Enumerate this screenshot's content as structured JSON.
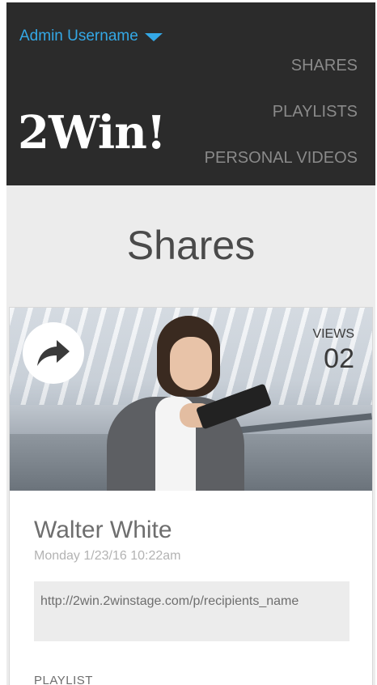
{
  "header": {
    "user_menu_label": "Admin Username",
    "logo": "2Win!",
    "nav": [
      {
        "label": "SHARES"
      },
      {
        "label": "PLAYLISTS"
      },
      {
        "label": "PERSONAL VIDEOS"
      }
    ]
  },
  "page": {
    "title": "Shares"
  },
  "card": {
    "views_label": "VIEWS",
    "views_count": "02",
    "name": "Walter White",
    "date": "Monday 1/23/16 10:22am",
    "url": "http://2win.2winstage.com/p/recipients_name",
    "playlist_label": "PLAYLIST"
  },
  "colors": {
    "header_bg": "#2b2b2b",
    "accent": "#34a8e6",
    "section_bg": "#ececec"
  },
  "icons": {
    "user_menu": "caret-down-icon",
    "share": "share-arrow-icon"
  }
}
